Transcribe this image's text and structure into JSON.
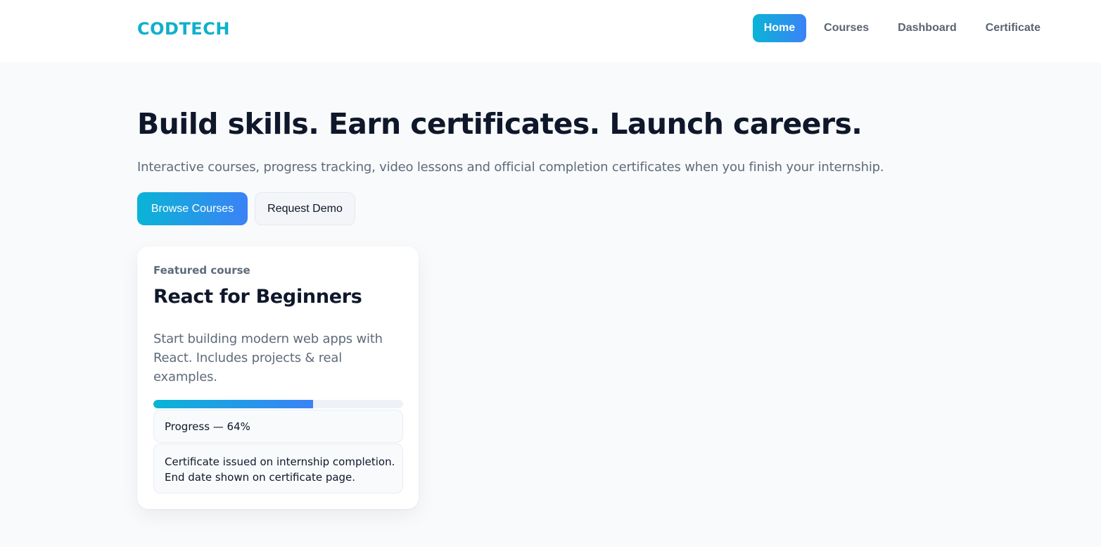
{
  "header": {
    "brand": "CODTECH",
    "nav": [
      {
        "label": "Home",
        "active": true
      },
      {
        "label": "Courses",
        "active": false
      },
      {
        "label": "Dashboard",
        "active": false
      },
      {
        "label": "Certificate",
        "active": false
      }
    ]
  },
  "hero": {
    "title": "Build skills. Earn certificates. Launch careers.",
    "subtitle": "Interactive courses, progress tracking, video lessons and official completion certificates when you finish your internship.",
    "primary_button": "Browse Courses",
    "secondary_button": "Request Demo"
  },
  "featured_course": {
    "kicker": "Featured course",
    "title": "React for Beginners",
    "description": "Start building modern web apps with React. Includes projects & real examples.",
    "progress_value": 64,
    "progress_label": "Progress — 64%",
    "certificate_line1": "Certificate issued on internship completion.",
    "certificate_line2": "End date shown on certificate page."
  },
  "colors": {
    "brand": "#0fb0cc",
    "gradient_start": "#0ab4d6",
    "gradient_end": "#3b82f6",
    "background": "#f8fafc"
  }
}
